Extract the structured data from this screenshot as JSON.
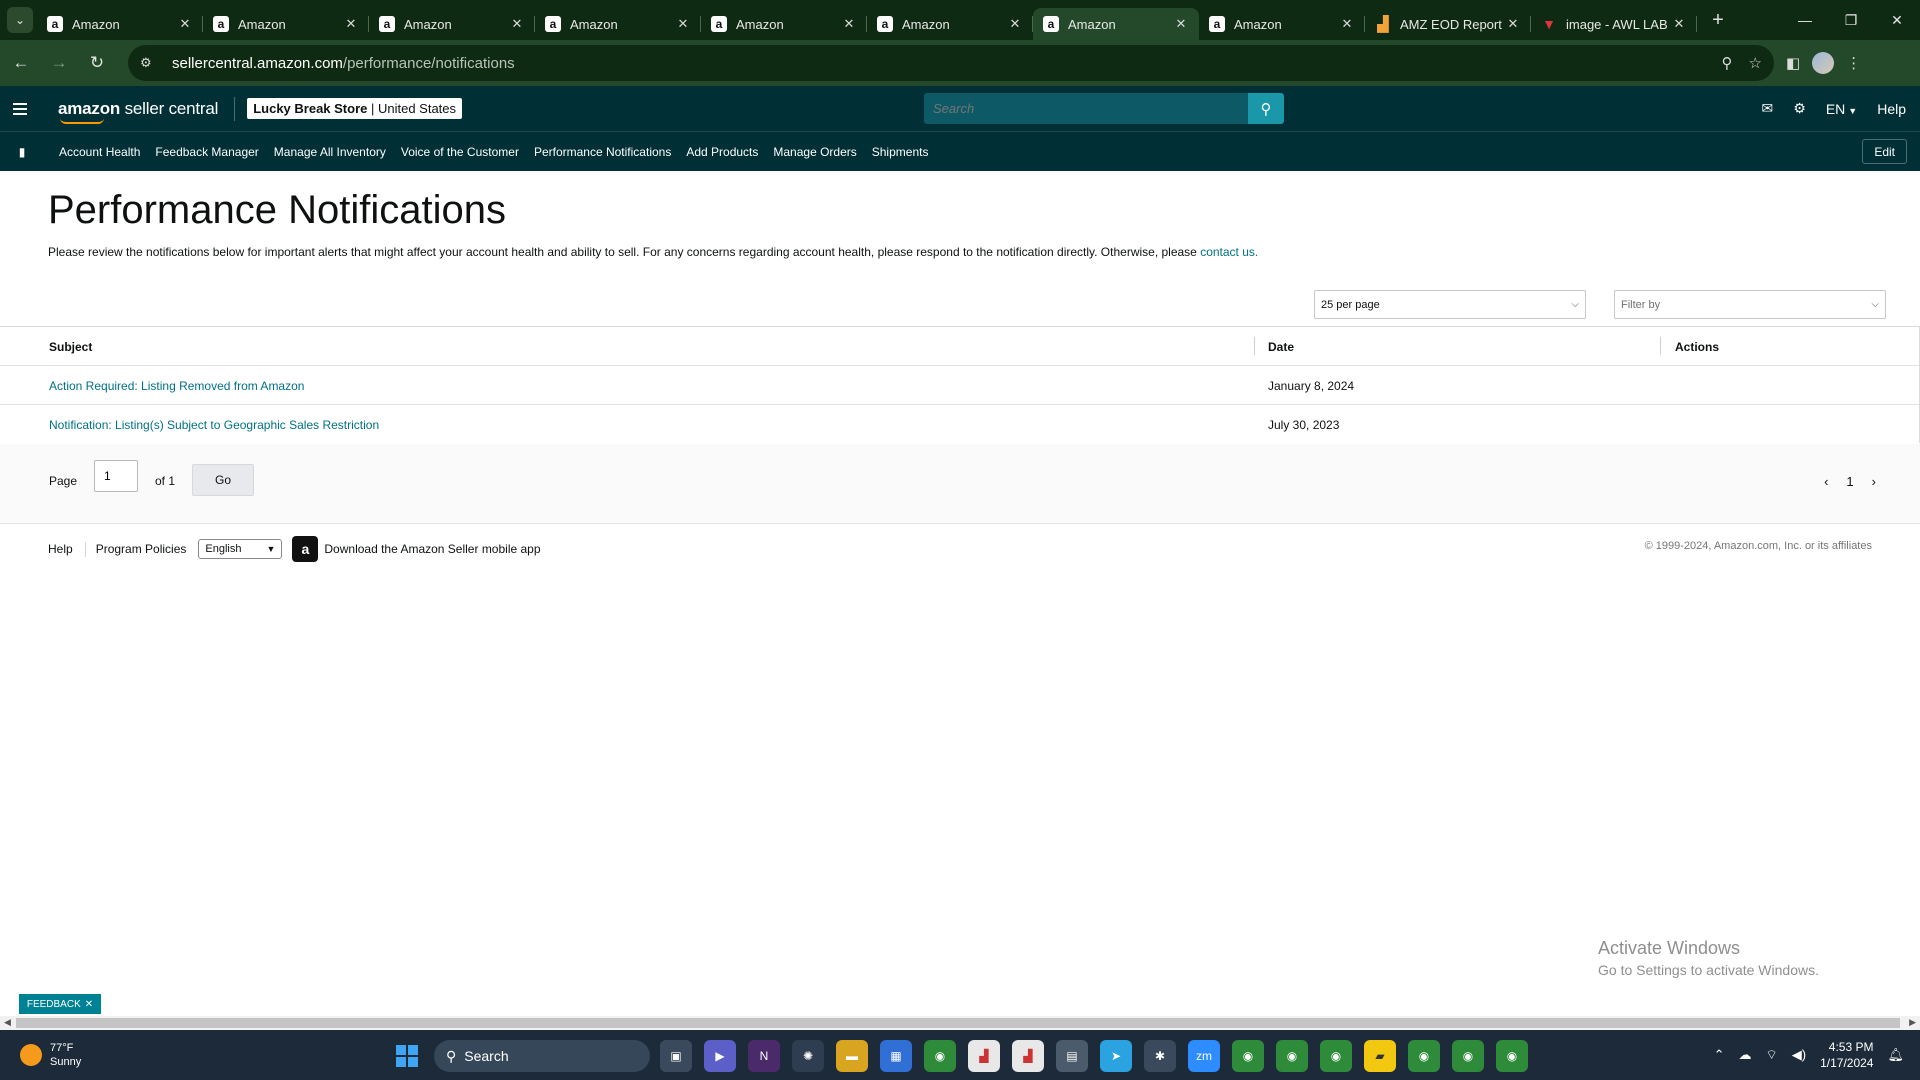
{
  "browser": {
    "tabs": [
      {
        "title": "Amazon",
        "favicon": "a",
        "active": false
      },
      {
        "title": "Amazon",
        "favicon": "a",
        "active": false
      },
      {
        "title": "Amazon",
        "favicon": "a",
        "active": false
      },
      {
        "title": "Amazon",
        "favicon": "a",
        "active": false
      },
      {
        "title": "Amazon",
        "favicon": "a",
        "active": false
      },
      {
        "title": "Amazon",
        "favicon": "a",
        "active": false
      },
      {
        "title": "Amazon",
        "favicon": "a",
        "active": true
      },
      {
        "title": "Amazon",
        "favicon": "a",
        "active": false
      },
      {
        "title": "AMZ EOD Report",
        "favicon": "chart",
        "active": false
      },
      {
        "title": "image - AWL LAB",
        "favicon": "img",
        "active": false
      }
    ],
    "url_host": "sellercentral.amazon.com",
    "url_path": "/performance/notifications"
  },
  "header": {
    "logo_bold": "amazon",
    "logo_rest": " seller central",
    "store_name": "Lucky Break Store",
    "store_region": "United States",
    "search_placeholder": "Search",
    "language": "EN",
    "help": "Help"
  },
  "bookmarks": {
    "items": [
      "Account Health",
      "Feedback Manager",
      "Manage All Inventory",
      "Voice of the Customer",
      "Performance Notifications",
      "Add Products",
      "Manage Orders",
      "Shipments"
    ],
    "edit_label": "Edit"
  },
  "page": {
    "title": "Performance Notifications",
    "description": "Please review the notifications below for important alerts that might affect your account health and ability to sell. For any concerns regarding account health, please respond to the notification directly. Otherwise, please ",
    "contact_link": "contact us.",
    "per_page": "25 per page",
    "filter_placeholder": "Filter by"
  },
  "table": {
    "headers": {
      "subject": "Subject",
      "date": "Date",
      "actions": "Actions"
    },
    "rows": [
      {
        "subject": "Action Required: Listing Removed from Amazon",
        "date": "January 8, 2024"
      },
      {
        "subject": "Notification: Listing(s) Subject to Geographic Sales Restriction",
        "date": "July 30, 2023"
      }
    ]
  },
  "pager": {
    "label": "Page",
    "current": "1",
    "of": "of 1",
    "go": "Go",
    "page_number": "1"
  },
  "footer": {
    "help": "Help",
    "policies": "Program Policies",
    "language": "English",
    "app": "Download the Amazon Seller mobile app",
    "copyright": "© 1999-2024, Amazon.com, Inc. or its affiliates"
  },
  "overlay": {
    "activate_title": "Activate Windows",
    "activate_sub": "Go to Settings to activate Windows.",
    "feedback": "FEEDBACK"
  },
  "taskbar": {
    "temp": "77°F",
    "condition": "Sunny",
    "search": "Search",
    "time": "4:53 PM",
    "date": "1/17/2024"
  },
  "colors": {
    "sc_header": "#002f36",
    "link": "#007185",
    "browser_frame": "#23492a"
  }
}
